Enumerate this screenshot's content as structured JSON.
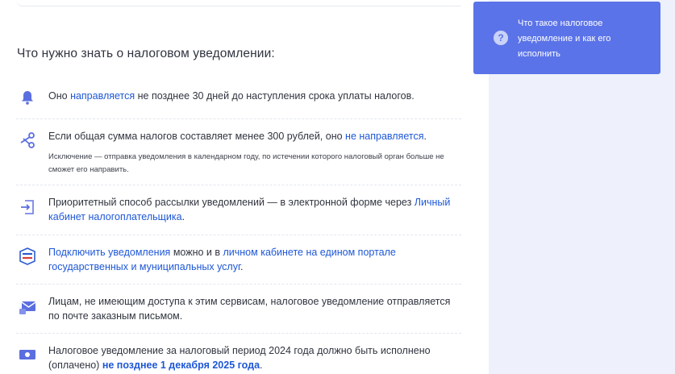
{
  "heading": "Что нужно знать о налоговом уведомлении:",
  "items": [
    {
      "icon": "bell-icon",
      "t1": "Оно ",
      "link1": "направляется",
      "t2": " не позднее 30 дней до наступления срока уплаты налогов."
    },
    {
      "icon": "scissors-icon",
      "t1": "Если общая сумма налогов составляет менее 300 рублей, оно ",
      "link1": "не направляется",
      "t2": ".",
      "note": "Исключение — отправка уведомления в календарном году, по истечении которого налоговый орган больше не сможет его направить."
    },
    {
      "icon": "login-icon",
      "t1": "Приоритетный способ рассылки уведомлений — в электронной форме через ",
      "link1": "Личный кабинет налогоплательщика",
      "t2": "."
    },
    {
      "icon": "gosuslugi-logo-icon",
      "link1": "Подключить уведомления",
      "t1": " можно и в  ",
      "link2": "личном кабинете на едином портале государственных и муниципальных услуг",
      "t2": "."
    },
    {
      "icon": "mail-lock-icon",
      "t1": "Лицам, не имеющим доступа к этим сервисам, налоговое уведомление отправляется по почте заказным письмом."
    },
    {
      "icon": "money-icon",
      "t1": "Налоговое уведомление за налоговый период 2024 года должно быть исполнено (оплачено) ",
      "bold_link": "не позднее 1 декабря 2025 года",
      "t2": "."
    }
  ],
  "sidebar": {
    "icon": "question-icon",
    "label": "Что такое налоговое уведомление и как его исполнить"
  },
  "colors": {
    "accent": "#5b73e8",
    "link": "#1e57d6",
    "icon": "#5b6ee0"
  }
}
